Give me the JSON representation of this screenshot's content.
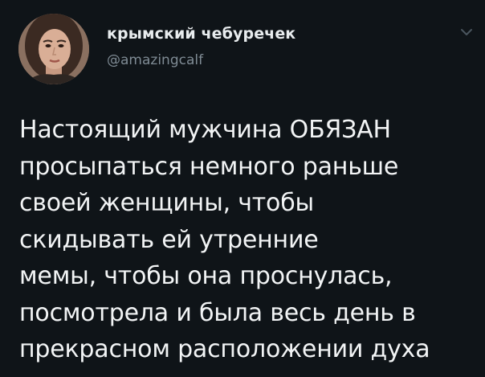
{
  "tweet": {
    "author": {
      "display_name": "крымский чебуречек",
      "handle": "@amazingcalf",
      "avatar_icon": "profile-photo"
    },
    "menu_icon": "chevron-down-icon",
    "text_lines": [
      "Настоящий мужчина ОБЯЗАН",
      "просыпаться немного раньше",
      "своей женщины, чтобы",
      "скидывать ей утренние",
      "мемы, чтобы она проснулась,",
      "посмотрела и была весь день в",
      "прекрасном расположении духа"
    ]
  },
  "colors": {
    "background": "#0f1418",
    "text": "#f2f4f5",
    "handle": "#7f8b94"
  }
}
